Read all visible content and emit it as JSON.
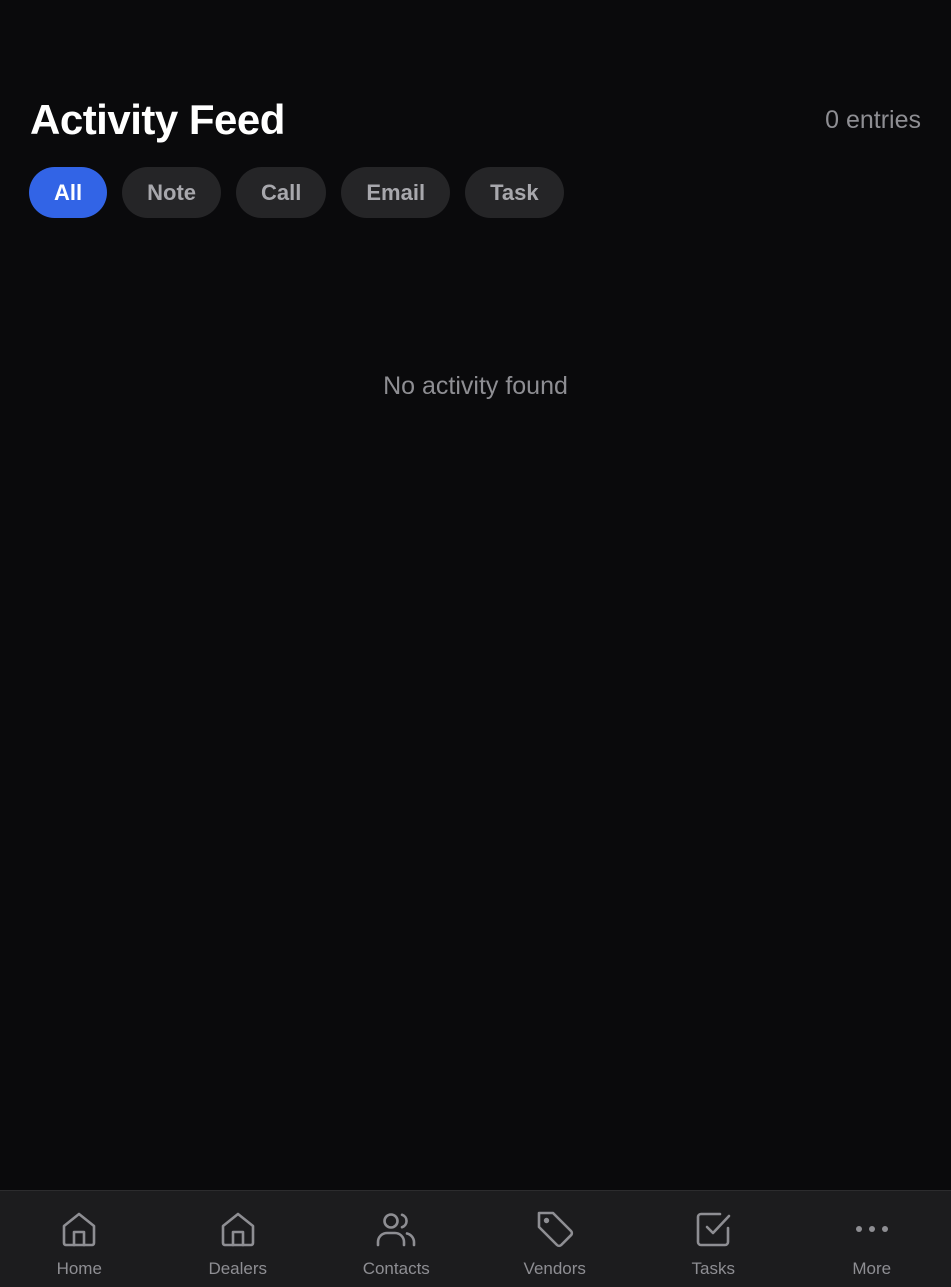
{
  "header": {
    "title": "Activity Feed",
    "entry_count": "0 entries"
  },
  "filters": [
    {
      "label": "All",
      "active": true
    },
    {
      "label": "Note",
      "active": false
    },
    {
      "label": "Call",
      "active": false
    },
    {
      "label": "Email",
      "active": false
    },
    {
      "label": "Task",
      "active": false
    }
  ],
  "empty_state": {
    "message": "No activity found"
  },
  "tabbar": {
    "items": [
      {
        "label": "Home",
        "icon": "home-icon"
      },
      {
        "label": "Dealers",
        "icon": "dealers-home-icon"
      },
      {
        "label": "Contacts",
        "icon": "users-icon"
      },
      {
        "label": "Vendors",
        "icon": "tag-icon"
      },
      {
        "label": "Tasks",
        "icon": "check-square-icon"
      },
      {
        "label": "More",
        "icon": "more-dots-icon"
      }
    ]
  },
  "colors": {
    "background": "#0a0a0c",
    "accent": "#3264e6",
    "chip": "#252527",
    "tabbar": "#1c1c1e",
    "muted_text": "#8e8e93"
  }
}
